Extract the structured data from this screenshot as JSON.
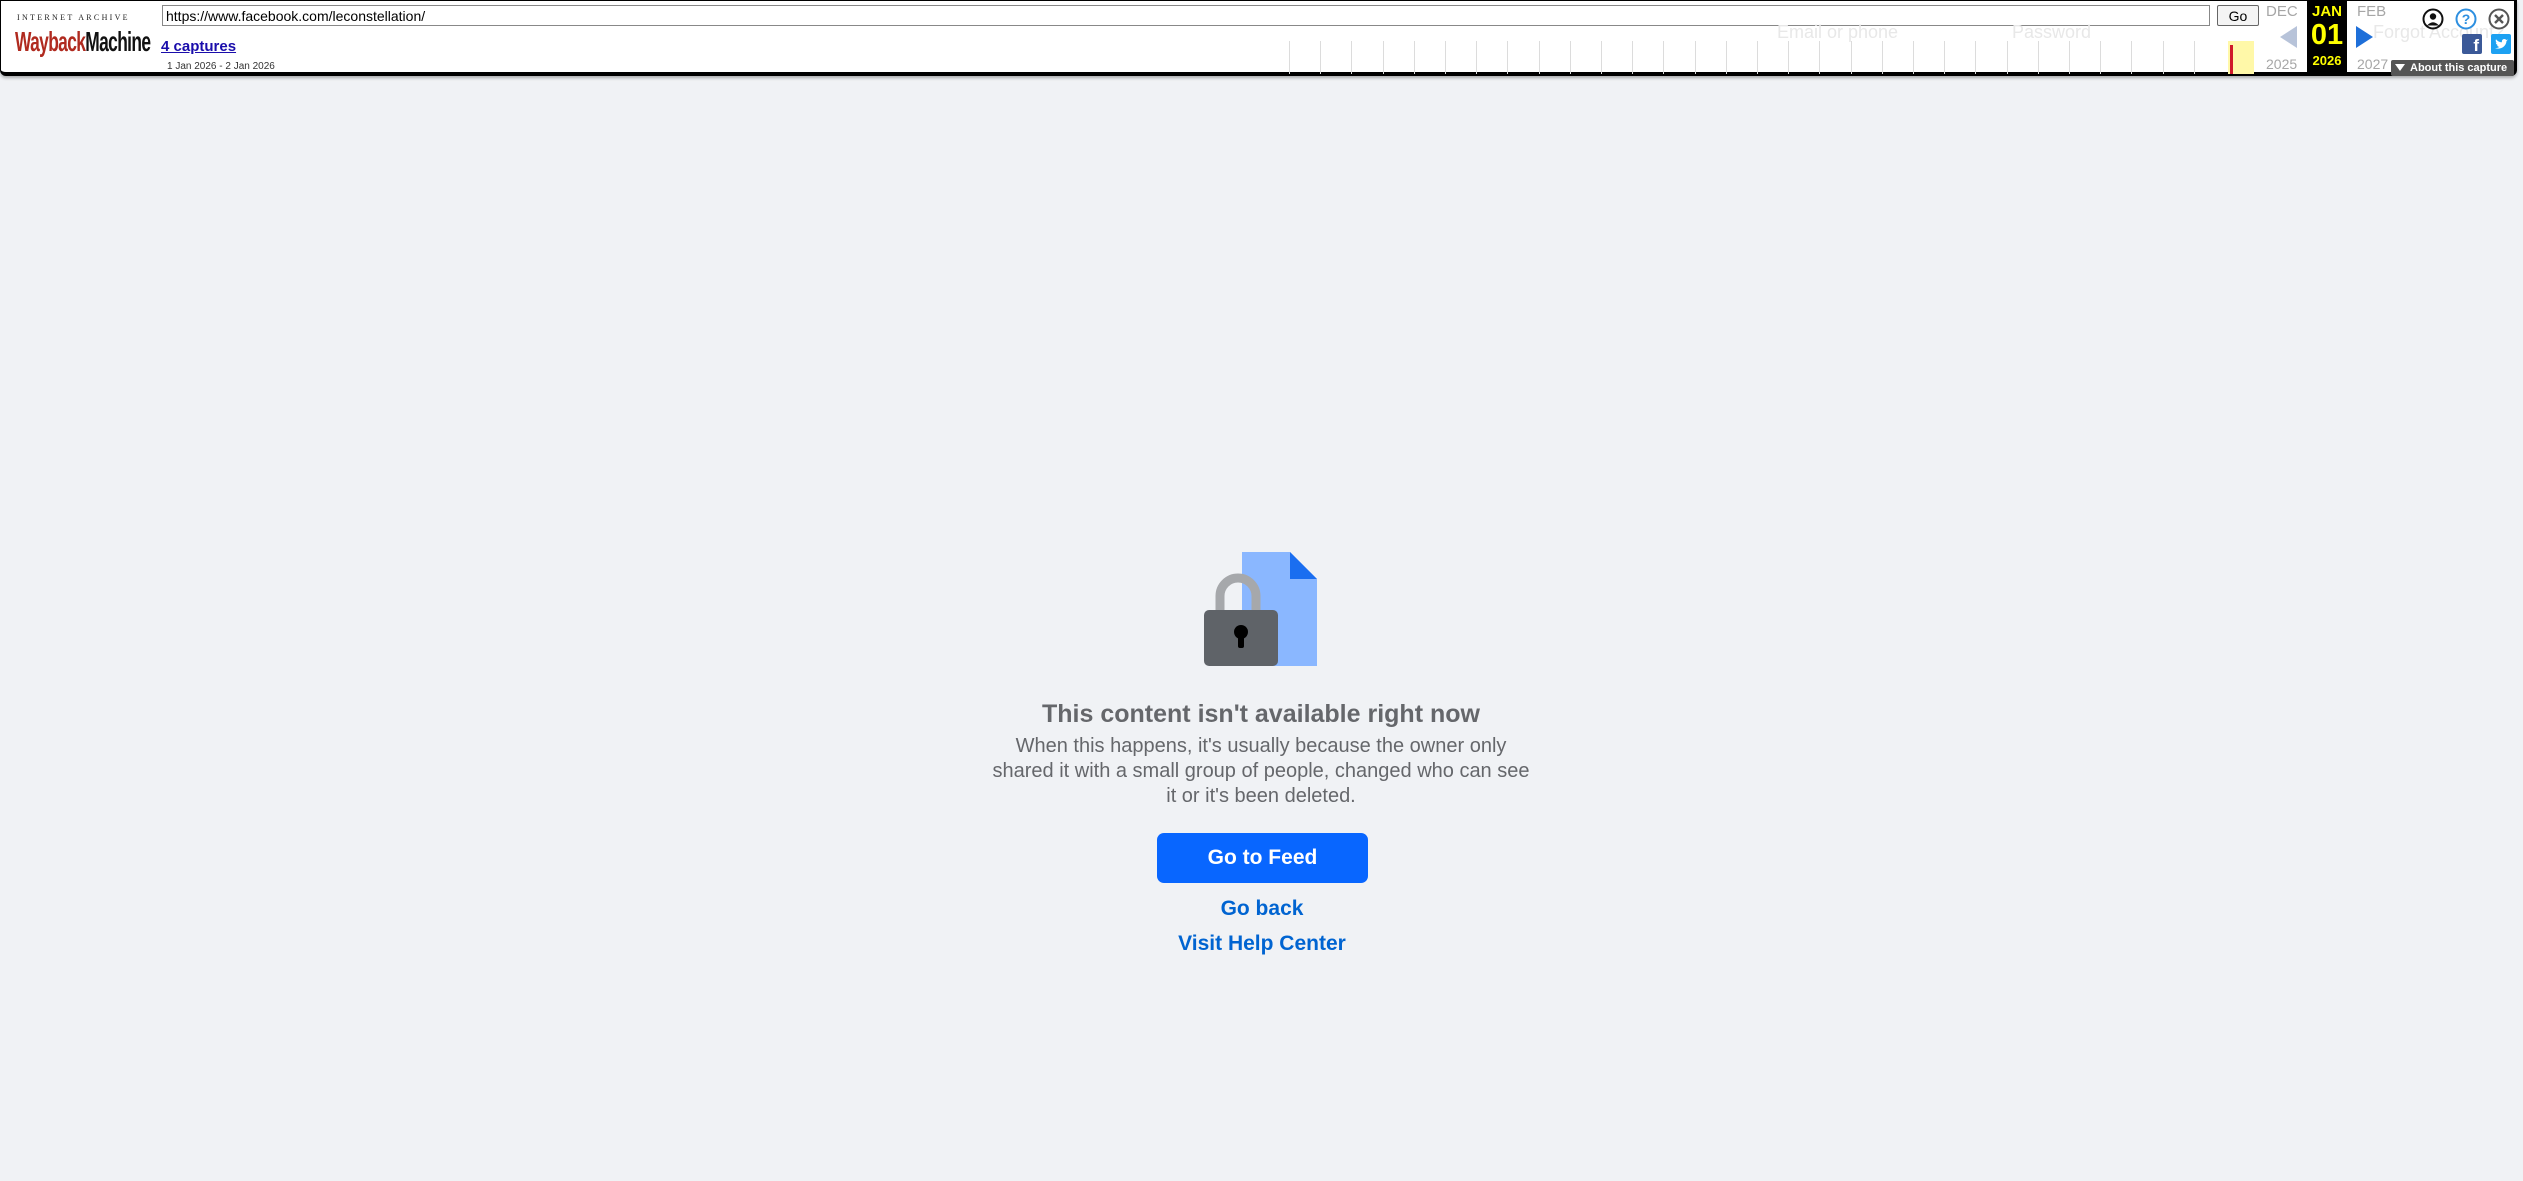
{
  "wayback": {
    "logo_top": "INTERNET ARCHIVE",
    "logo_wayback": "Wayback",
    "logo_machine": "Machine",
    "url_value": "https://www.facebook.com/leconstellation/",
    "go_label": "Go",
    "captures_link": "4 captures",
    "capture_range": "1 Jan 2026 - 2 Jan 2026",
    "prev_month": "DEC",
    "current_month": "JAN",
    "current_day": "01",
    "next_month": "FEB",
    "prev_year": "2025",
    "current_year": "2026",
    "next_year": "2027",
    "about_capture": "About this capture",
    "ghost_email": "Email or phone",
    "ghost_password": "Password",
    "ghost_forgot": "Forgot Account?",
    "icons": [
      "user-icon",
      "help-icon",
      "close-icon",
      "facebook-icon",
      "twitter-icon"
    ],
    "colors": {
      "current_bg": "#000000",
      "current_text": "#ffff00",
      "capture_mark": "#d01a2a"
    }
  },
  "error_page": {
    "title": "This content isn't available right now",
    "body": "When this happens, it's usually because the owner only shared it with a small group of people, changed who can see it or it's been deleted.",
    "primary_button": "Go to Feed",
    "go_back": "Go back",
    "help_center": "Visit Help Center",
    "icon": "locked-document-icon",
    "colors": {
      "background": "#f0f2f5",
      "button": "#0866ff",
      "link": "#0064d1",
      "text": "#65676b"
    }
  }
}
